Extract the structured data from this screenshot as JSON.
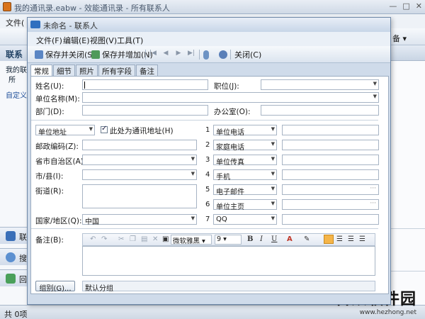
{
  "main_window": {
    "title": "我的通讯录.eabw - 效能通讯录 - 所有联系人",
    "win_buttons": [
      "—",
      "□",
      "✕"
    ],
    "menu_file": "文件(",
    "toolbar_right_label": "备 ▾",
    "left_panel": {
      "header": "联系",
      "item_mine": "我的联",
      "item_all": "所",
      "item_custom": "自定义",
      "nav1": "联",
      "nav2": "搜",
      "nav3": "回"
    },
    "status": "共 0项"
  },
  "watermark": {
    "brand": "合众软件园",
    "url": "www.hezhong.net"
  },
  "dialog": {
    "title": "未命名 - 联系人",
    "menu": [
      "文件(F)",
      "编辑(E)",
      "视图(V)",
      "工具(T)"
    ],
    "toolbar": {
      "save_close": "保存并关闭(S)",
      "save_add": "保存并增加(N)",
      "close": "关闭(C)"
    },
    "tabs": [
      "常规",
      "细节",
      "照片",
      "所有字段",
      "备注"
    ],
    "form": {
      "name_label": "姓名(U):",
      "name_value": "",
      "position_label": "职位(J):",
      "company_label": "单位名称(M):",
      "dept_label": "部门(D):",
      "office_label": "办公室(O):",
      "address_type": "单位地址",
      "mailing_check_label": "此处为通讯地址(H)",
      "zip_label": "邮政编码(Z):",
      "province_label": "省市自治区(A):",
      "city_label": "市/县(I):",
      "street_label": "街道(R):",
      "country_label": "国家/地区(Q):",
      "country_value": "中国",
      "phones": [
        {
          "num": "1",
          "type": "单位电话"
        },
        {
          "num": "2",
          "type": "家庭电话"
        },
        {
          "num": "3",
          "type": "单位传真"
        },
        {
          "num": "4",
          "type": "手机"
        },
        {
          "num": "5",
          "type": "电子邮件"
        },
        {
          "num": "6",
          "type": "单位主页"
        },
        {
          "num": "7",
          "type": "QQ"
        }
      ],
      "notes_label": "备注(B):",
      "font_name": "微软雅黑",
      "font_size": "9",
      "bold": "B",
      "italic": "I",
      "underline": "U",
      "color_a": "A",
      "group_button": "组别(G)...",
      "group_value": "默认分组"
    }
  },
  "colors": {
    "dialog_bg": "#cfdbea",
    "accent_orange": "#f5b549",
    "title_blue": "#2f6fbf"
  }
}
